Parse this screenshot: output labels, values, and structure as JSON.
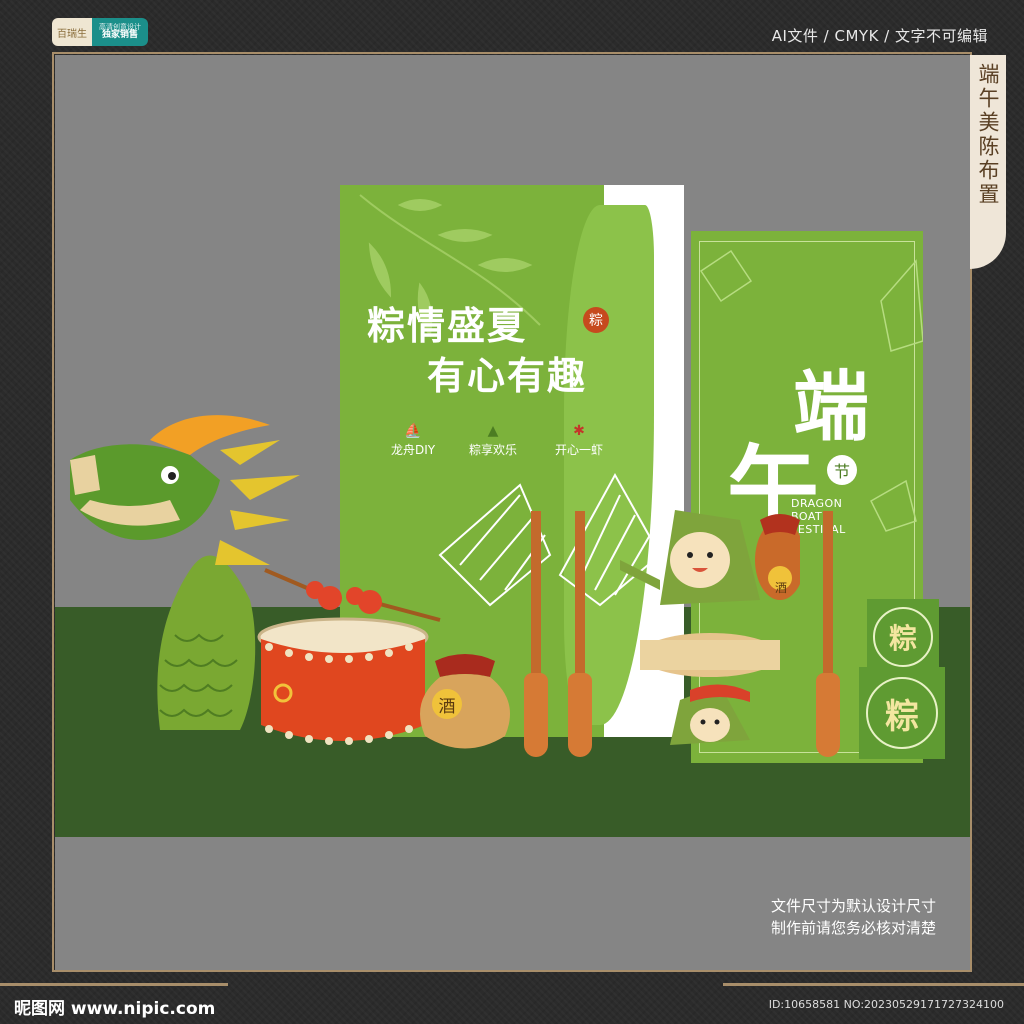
{
  "badge": {
    "brand": "百瑞生",
    "sub": "高清创意设计",
    "exclusive": "独家销售"
  },
  "top_info": "AI文件 / CMYK / 文字不可编辑",
  "side_tab": "端午美陈布置",
  "panel_left": {
    "headline_line1": "粽情盛夏",
    "stamp": "粽",
    "headline_line2": "有心有趣",
    "activities": [
      "龙舟DIY",
      "粽享欢乐",
      "开心一虾"
    ]
  },
  "panel_right": {
    "char1": "端",
    "char2": "午",
    "seal": "节",
    "english_line1": "DRAGON",
    "english_line2": "BOAT",
    "english_line3": "FESTIVAL"
  },
  "signs": [
    "粽",
    "粽"
  ],
  "jar_label": "酒",
  "character_jar_label": "酒",
  "note_line1": "文件尺寸为默认设计尺寸",
  "note_line2": "制作前请您务必核对清楚",
  "footer_logo": "昵图网 www.nipic.com",
  "footer_id": "ID:10658581 NO:20230529171727324100",
  "colors": {
    "panel_green": "#7cb23b",
    "floor_green": "#385c28",
    "background_gray": "#858585",
    "gold_line": "#a88e6a"
  }
}
